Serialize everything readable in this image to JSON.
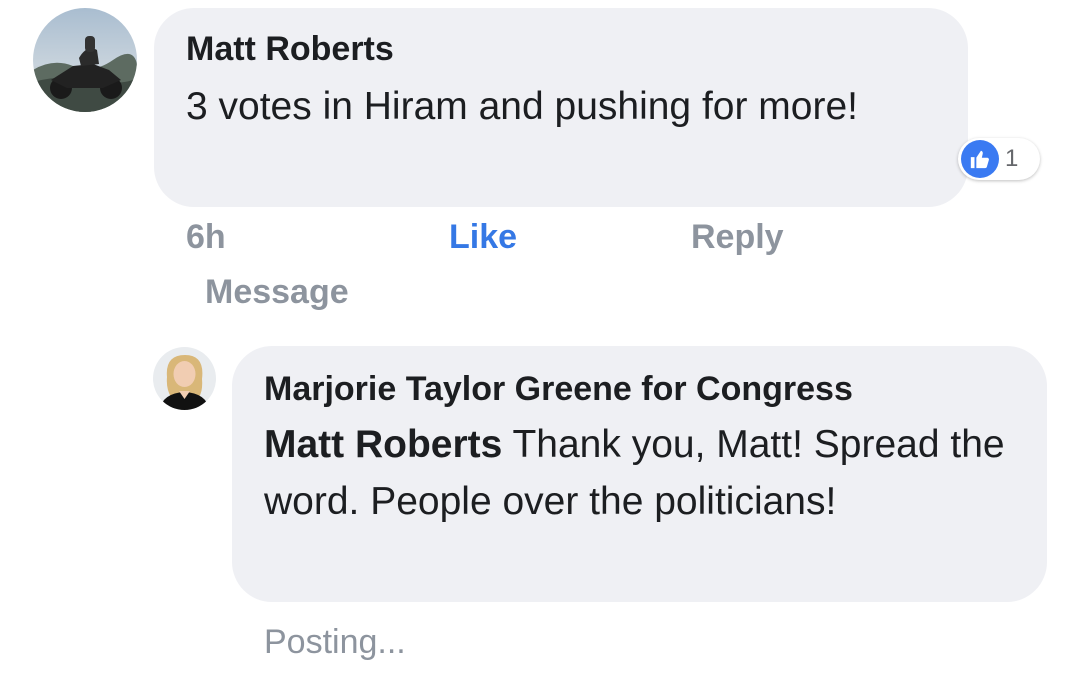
{
  "comment": {
    "author": "Matt Roberts",
    "text": "3 votes in Hiram and pushing for more!",
    "reaction": {
      "icon": "like-icon",
      "count": "1",
      "color": "#3a7af2"
    },
    "actions": {
      "time": "6h",
      "like": "Like",
      "reply": "Reply",
      "message": "Message"
    },
    "avatar_icon": "motorcycle-avatar"
  },
  "reply": {
    "author": "Marjorie Taylor Greene for Congress",
    "mention": "Matt Roberts",
    "text": " Thank you, Matt! Spread the word. People over the politicians!",
    "status": "Posting...",
    "avatar_icon": "woman-portrait-avatar"
  },
  "colors": {
    "bubble": "#eff0f4",
    "link_blue": "#3578e5",
    "muted": "#8d949e"
  }
}
